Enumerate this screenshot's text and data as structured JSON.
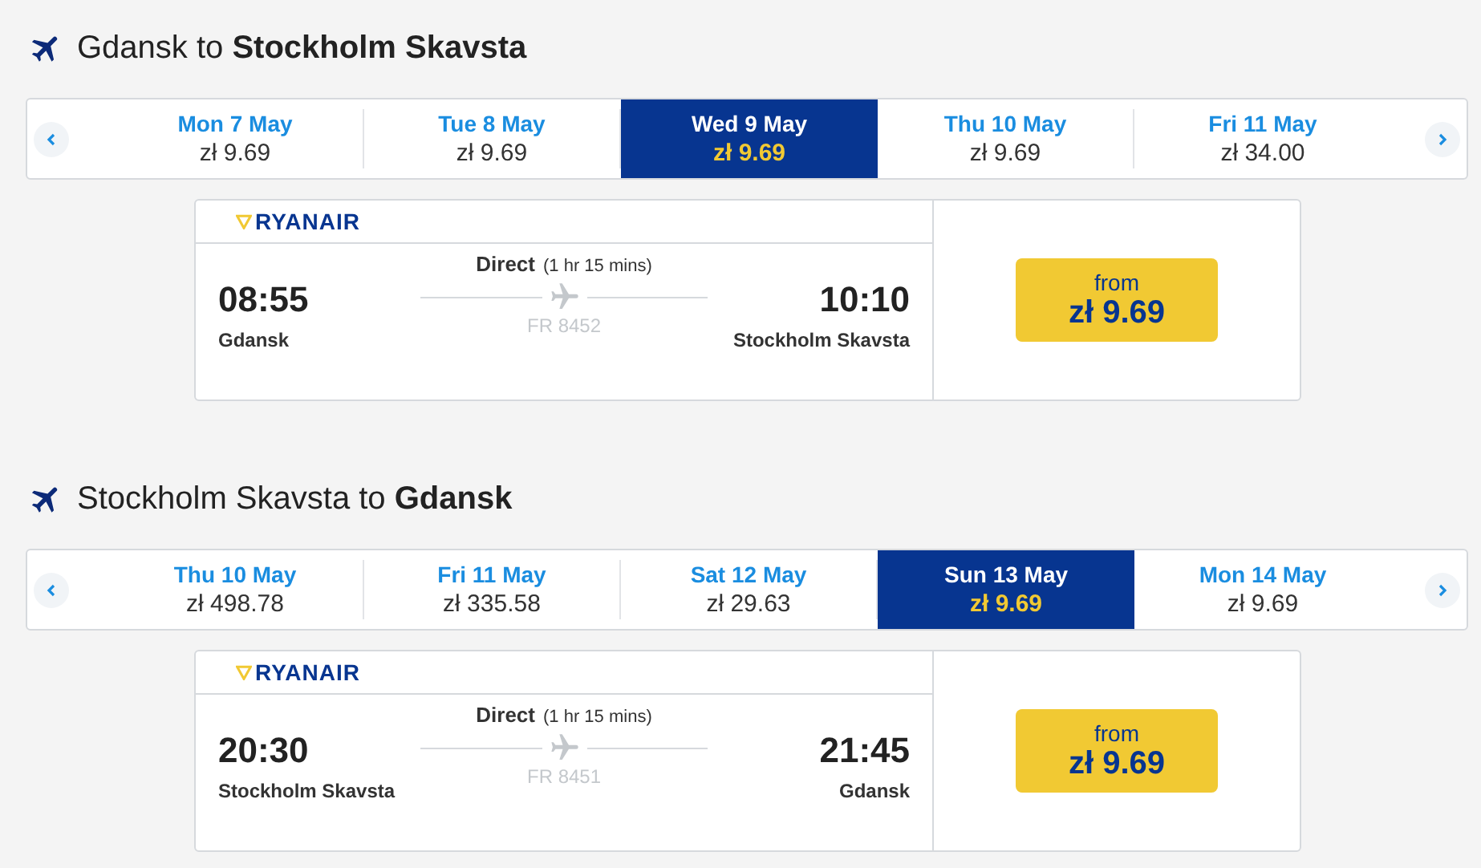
{
  "journeys": [
    {
      "title": "Gdansk to **Stockholm Skavsta**",
      "dates": [
        {
          "day": "Mon 7 May",
          "price": "zł 9.69",
          "selected": false
        },
        {
          "day": "Tue 8 May",
          "price": "zł 9.69",
          "selected": false
        },
        {
          "day": "Wed 9 May",
          "price": "zł 9.69",
          "selected": true
        },
        {
          "day": "Thu 10 May",
          "price": "zł 9.69",
          "selected": false
        },
        {
          "day": "Fri 11 May",
          "price": "zł 34.00",
          "selected": false
        }
      ],
      "flight": {
        "airline": "RYANAIR",
        "type": "Direct",
        "duration": "(1 hr 15 mins)",
        "depart_time": "08:55",
        "depart_city": "Gdansk",
        "arrive_time": "10:10",
        "arrive_city": "Stockholm Skavsta",
        "flight_number": "FR 8452",
        "price_label": "from",
        "price": "zł 9.69"
      }
    },
    {
      "title": "Stockholm Skavsta to **Gdansk**",
      "dates": [
        {
          "day": "Thu 10 May",
          "price": "zł 498.78",
          "selected": false
        },
        {
          "day": "Fri 11 May",
          "price": "zł 335.58",
          "selected": false
        },
        {
          "day": "Sat 12 May",
          "price": "zł 29.63",
          "selected": false
        },
        {
          "day": "Sun 13 May",
          "price": "zł 9.69",
          "selected": true
        },
        {
          "day": "Mon 14 May",
          "price": "zł 9.69",
          "selected": false
        }
      ],
      "flight": {
        "airline": "RYANAIR",
        "type": "Direct",
        "duration": "(1 hr 15 mins)",
        "depart_time": "20:30",
        "depart_city": "Stockholm Skavsta",
        "arrive_time": "21:45",
        "arrive_city": "Gdansk",
        "flight_number": "FR 8451",
        "price_label": "from",
        "price": "zł 9.69"
      }
    }
  ]
}
